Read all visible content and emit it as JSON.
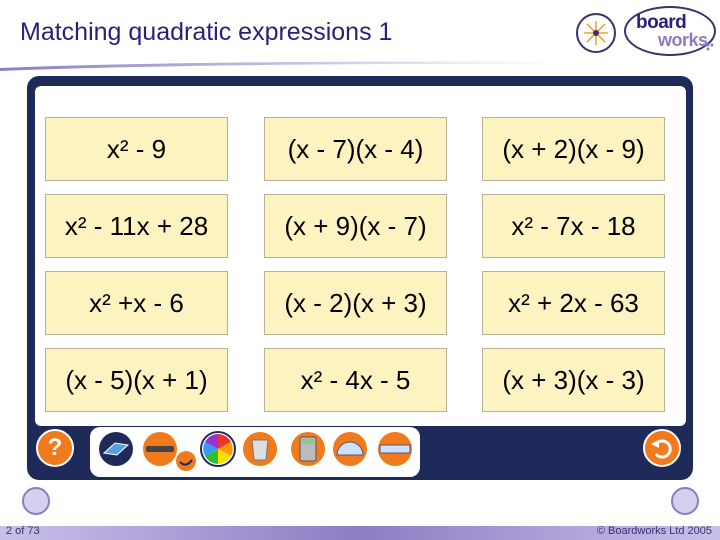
{
  "title": "Matching quadratic expressions 1",
  "logo": {
    "line1": "board",
    "line2": "works"
  },
  "cards": [
    [
      "x² - 9",
      "(x - 7)(x - 4)",
      "(x + 2)(x - 9)"
    ],
    [
      "x² - 11x + 28",
      "(x + 9)(x - 7)",
      "x² - 7x - 18"
    ],
    [
      "x² +x - 6",
      "(x - 2)(x + 3)",
      "x² + 2x - 63"
    ],
    [
      "(x - 5)(x + 1)",
      "x² - 4x - 5",
      "(x + 3)(x - 3)"
    ]
  ],
  "help_label": "?",
  "tools": [
    "eraser-icon",
    "pen-icon",
    "colour-wheel-icon",
    "bin-icon",
    "calculator-icon",
    "protractor-icon",
    "ruler-icon"
  ],
  "footer": {
    "page": "2 of 73",
    "copyright": "© Boardworks Ltd 2005"
  },
  "colors": {
    "frame": "#1d2a5a",
    "card": "#fdf3c0",
    "accent": "#f07a1c",
    "title": "#2b1f7a"
  }
}
